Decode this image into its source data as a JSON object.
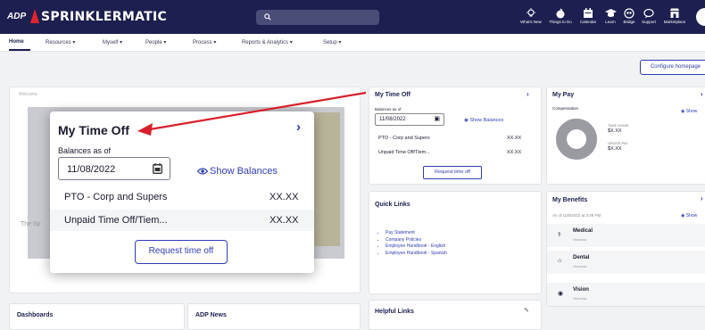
{
  "header": {
    "logo_text": "ADP",
    "brand": "SPRINKLERMATIC",
    "icons": [
      {
        "label": "What's New",
        "icon": "lightbulb-icon"
      },
      {
        "label": "Things to Do",
        "icon": "checklist-icon"
      },
      {
        "label": "Calendar",
        "icon": "calendar-icon"
      },
      {
        "label": "Learn",
        "icon": "graduation-cap-icon"
      },
      {
        "label": "Bridge",
        "icon": "people-icon"
      },
      {
        "label": "Support",
        "icon": "chat-icon"
      },
      {
        "label": "Marketplace",
        "icon": "store-icon"
      }
    ]
  },
  "nav": {
    "items": [
      "Home",
      "Resources",
      "Myself",
      "People",
      "Process",
      "Reports & Analytics",
      "Setup"
    ]
  },
  "config_button": "Configure homepage",
  "welcome": {
    "title": "Welcome",
    "caption": "The Sp"
  },
  "time_off_card": {
    "title": "My Time Off",
    "balances_label": "Balances as of",
    "date": "11/08/2022",
    "show_balances": "Show Balances",
    "rows": [
      {
        "name": "PTO - Corp and Supers",
        "value": "XX.XX"
      },
      {
        "name": "Unpaid Time Off/Tiem...",
        "value": "XX.XX"
      }
    ],
    "request_button": "Request time off"
  },
  "overlay": {
    "title": "My Time Off",
    "balances_label": "Balances as of",
    "date": "11/08/2022",
    "show_balances": "Show Balances",
    "rows": [
      {
        "name": "PTO - Corp and Supers",
        "value": "XX.XX"
      },
      {
        "name": "Unpaid Time Off/Tiem...",
        "value": "XX.XX"
      }
    ],
    "request_button": "Request time off"
  },
  "pay_card": {
    "title": "My Pay",
    "compensation_label": "Compensation",
    "show": "Show",
    "take_home_label": "TAKE HOME",
    "take_home_value": "$X.XX",
    "gross_label": "GROSS PAY",
    "gross_value": "$X.XX"
  },
  "quick_links": {
    "title": "Quick Links",
    "links": [
      "Pay Statement",
      "Company Policies",
      "Employee Handbook - English",
      "Employee Handbook - Spanish"
    ]
  },
  "benefits": {
    "title": "My Benefits",
    "as_of": "As of 11/8/2022 at 3:09 PM",
    "show": "Show",
    "items": [
      {
        "name": "Medical",
        "status": "Humana"
      },
      {
        "name": "Dental",
        "status": "Humana"
      },
      {
        "name": "Vision",
        "status": "Humana"
      }
    ]
  },
  "bottom_cards": {
    "dashboards": "Dashboards",
    "adp_news": "ADP News",
    "helpful_links": "Helpful Links"
  },
  "colors": {
    "header_bg": "#1c1f4f",
    "accent": "#2f3db5",
    "arrow": "#d8202a",
    "brand_red": "#e0242e"
  }
}
